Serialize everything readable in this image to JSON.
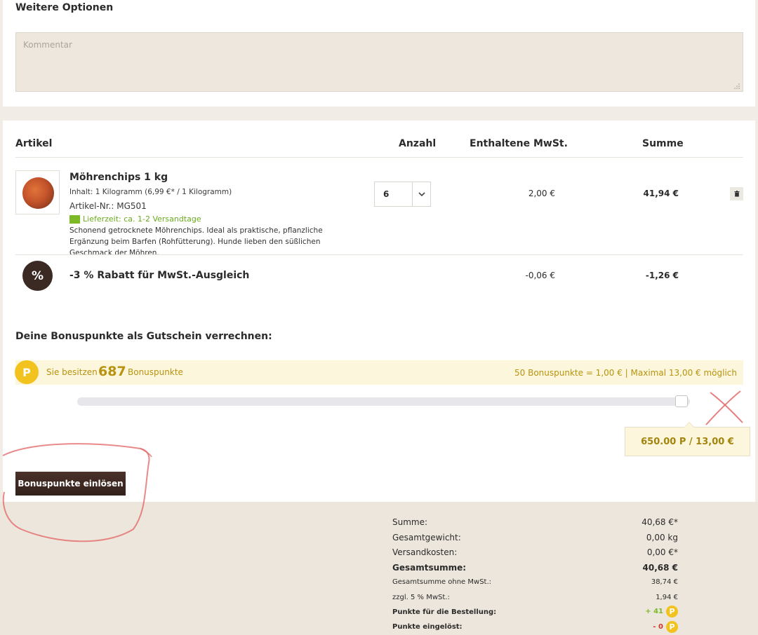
{
  "options": {
    "title": "Weitere Optionen",
    "comment_placeholder": "Kommentar"
  },
  "table": {
    "headers": {
      "article": "Artikel",
      "quantity": "Anzahl",
      "vat": "Enthaltene MwSt.",
      "sum": "Summe"
    }
  },
  "product": {
    "name": "Möhrenchips 1 kg",
    "content": "Inhalt: 1 Kilogramm (6,99 €* / 1 Kilogramm)",
    "sku": "Artikel-Nr.: MG501",
    "delivery": "Lieferzeit: ca. 1-2 Versandtage",
    "description": "Schonend getrocknete Möhrenchips. Ideal als praktische, pflanzliche Ergänzung beim Barfen (Rohfütterung). Hunde lieben den süßlichen Geschmack der Möhren.",
    "quantity": "6",
    "vat": "2,00 €",
    "sum": "41,94 €"
  },
  "discount": {
    "icon_label": "%",
    "name": "-3 % Rabatt für MwSt.-Ausgleich",
    "vat": "-0,06 €",
    "sum": "-1,26 €"
  },
  "bonus": {
    "title": "Deine Bonuspunkte als Gutschein verrechnen:",
    "coin_label": "P",
    "have_prefix": "Sie besitzen",
    "points": "687",
    "have_suffix": "Bonuspunkte",
    "rate_info": "50 Bonuspunkte = 1,00 € | Maximal 13,00 € möglich",
    "slider_level": 1.0,
    "tooltip": "650.00 P / 13,00 €",
    "redeem_button": "Bonuspunkte einlösen"
  },
  "summary": {
    "rows": [
      {
        "label": "Summe:",
        "value": "40,68 €*"
      },
      {
        "label": "Gesamtgewicht:",
        "value": "0,00 kg"
      },
      {
        "label": "Versandkosten:",
        "value": "0,00 €*"
      },
      {
        "label": "Gesamtsumme:",
        "value": "40,68 €"
      },
      {
        "label": "Gesamtsumme ohne MwSt.:",
        "value": "38,74 €"
      },
      {
        "label": "zzgl. 5 % MwSt.:",
        "value": "1,94 €"
      }
    ],
    "points_order_label": "Punkte für die Bestellung:",
    "points_order_value": "+ 41",
    "points_redeemed_label": "Punkte eingelöst:",
    "points_redeemed_value": "- 0"
  },
  "colors": {
    "accent_gold": "#f2c31e",
    "brand_brown": "#3b2a24",
    "delivery_green": "#7bb927",
    "annotation_red": "#e36b6b"
  }
}
